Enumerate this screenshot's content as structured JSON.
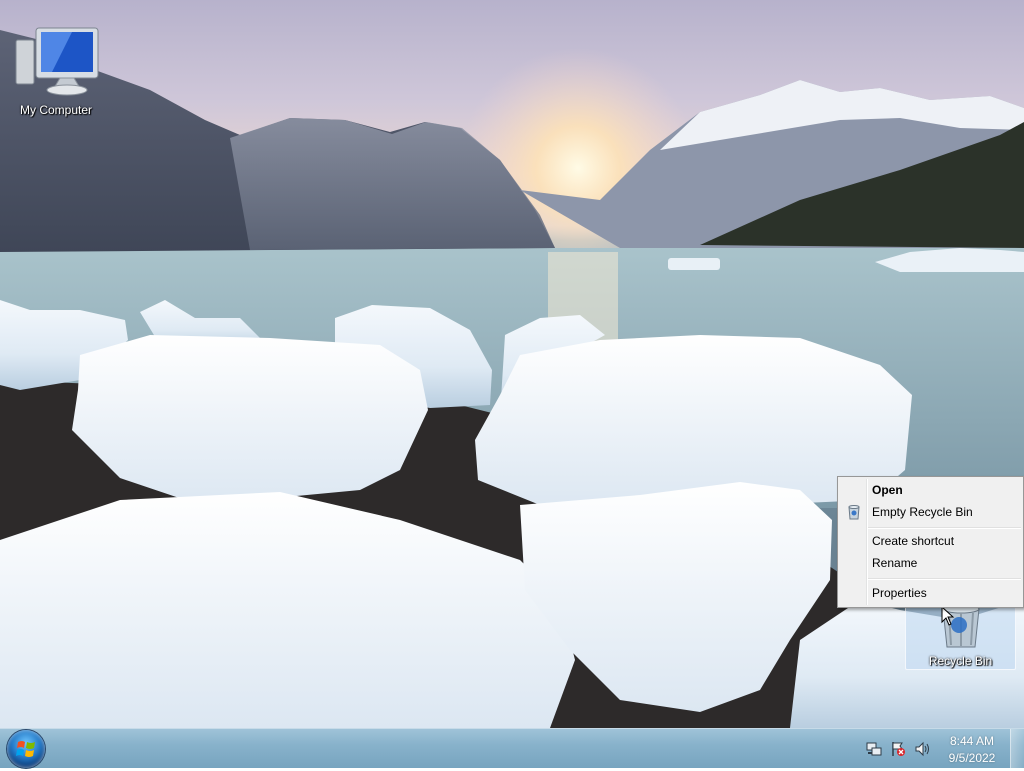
{
  "desktop": {
    "wallpaper_icon": "glacier-landscape",
    "icons": [
      {
        "label": "My Computer",
        "icon": "computer-monitor-icon"
      },
      {
        "label": "Recycle Bin",
        "icon": "recycle-bin-icon"
      }
    ]
  },
  "context_menu": {
    "items": [
      {
        "label": "Open",
        "default": true
      },
      {
        "label": "Empty Recycle Bin",
        "icon": "recycle-bin-small-icon"
      },
      {
        "label": "Create shortcut"
      },
      {
        "label": "Rename"
      },
      {
        "label": "Properties"
      }
    ]
  },
  "taskbar": {
    "start_icon": "windows-start-orb-icon",
    "tray_icons": [
      "network-icon",
      "action-center-flag-icon",
      "speaker-icon"
    ],
    "clock": {
      "time": "8:44 AM",
      "date": "9/5/2022"
    }
  },
  "colors": {
    "taskbar": "#88b2cb",
    "menu_bg": "#f0f0f0",
    "selection": "#bed7f0"
  }
}
